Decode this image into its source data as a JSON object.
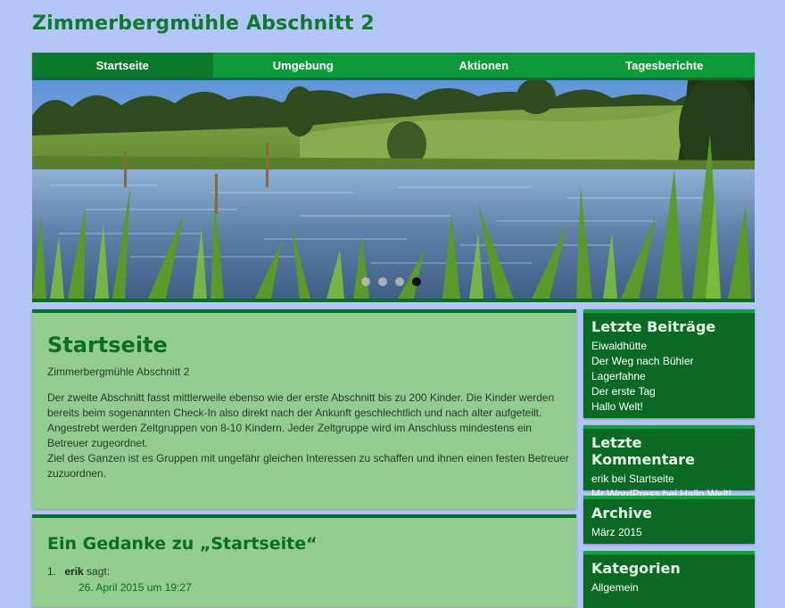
{
  "header": {
    "site_title": "Zimmerbergmühle Abschnitt 2"
  },
  "nav": {
    "items": [
      {
        "label": "Startseite",
        "active": true
      },
      {
        "label": "Umgebung"
      },
      {
        "label": "Aktionen"
      },
      {
        "label": "Tagesberichte"
      }
    ]
  },
  "slider": {
    "dot_count": 4,
    "active_dot": 3
  },
  "main": {
    "title": "Startseite",
    "subtitle": "Zimmerbergmühle Abschnitt 2",
    "paragraphs": [
      "Der zweite Abschnitt fasst mittlerweile ebenso wie der erste Abschnitt bis zu 200 Kinder. Die Kinder werden bereits beim sogenannten Check-In also direkt nach der Ankunft geschlechtlich und nach alter aufgeteilt. Angestrebt werden Zeltgruppen von 8-10 Kindern. Jeder Zeltgruppe wird im Anschluss mindestens ein Betreuer zugeordnet.",
      "Ziel des Ganzen ist es Gruppen mit ungefähr gleichen Interessen zu schaffen und ihnen einen festen Betreuer zuzuordnen."
    ]
  },
  "comments": {
    "title": "Ein Gedanke zu „Startseite“",
    "items": [
      {
        "number": "1.",
        "author": "erik",
        "said": "sagt:",
        "date": "26. April 2015 um 19:27"
      }
    ]
  },
  "sidebar": {
    "recent_posts": {
      "title": "Letzte Beiträge",
      "items": [
        "Eiwaldhütte",
        "Der Weg nach Bühler",
        "Lagerfahne",
        "Der erste Tag",
        "Hallo Welt!"
      ]
    },
    "recent_comments": {
      "title": "Letzte Kommentare",
      "items": [
        "erik bei Startseite",
        "Mr WordPress bei Hallo Welt!"
      ]
    },
    "archive": {
      "title": "Archive",
      "items": [
        "März 2015"
      ]
    },
    "categories": {
      "title": "Kategorien",
      "items": [
        "Allgemein"
      ]
    }
  },
  "colors": {
    "background": "#b3c6f7",
    "nav": "#0f9a3a",
    "content_box": "#93cc8f",
    "sidebar_widget": "#0a6a24",
    "title_green": "#0f7a2e"
  }
}
